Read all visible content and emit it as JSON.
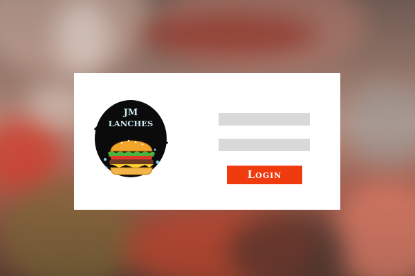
{
  "brand": {
    "line1": "JM",
    "line2": "LANCHES",
    "icon": "burger-logo-icon"
  },
  "login": {
    "username_placeholder": "",
    "password_placeholder": "",
    "button_label": "Login"
  },
  "colors": {
    "button": "#f03b0f",
    "field": "#d9d9d9",
    "panel": "#ffffff"
  }
}
